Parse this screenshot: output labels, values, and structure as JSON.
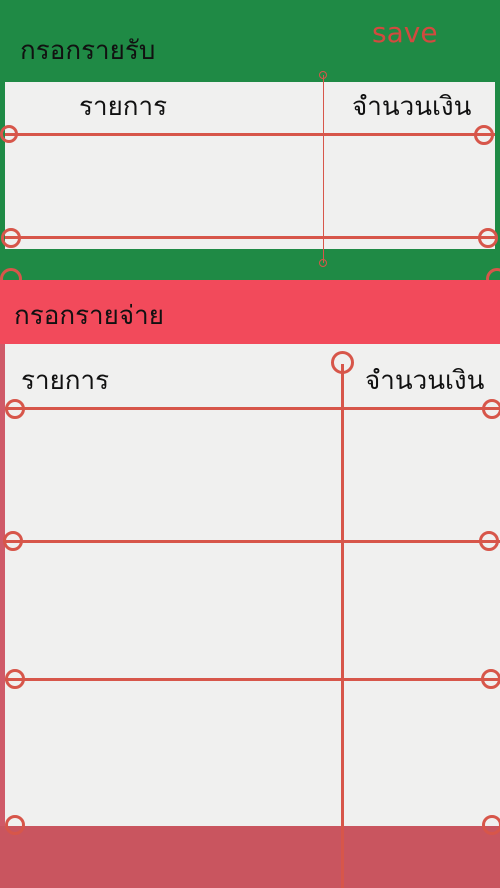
{
  "income": {
    "title": "กรอกรายรับ",
    "save_label": "save",
    "col_item": "รายการ",
    "col_amount": "จำนวนเงิน"
  },
  "expense": {
    "title": "กรอกรายจ่าย",
    "col_item": "รายการ",
    "col_amount": "จำนวนเงิน"
  },
  "colors": {
    "income_bg": "#1f8a45",
    "expense_bg": "#f24a5b",
    "line": "#d7564a",
    "card": "#f0f0ef"
  }
}
